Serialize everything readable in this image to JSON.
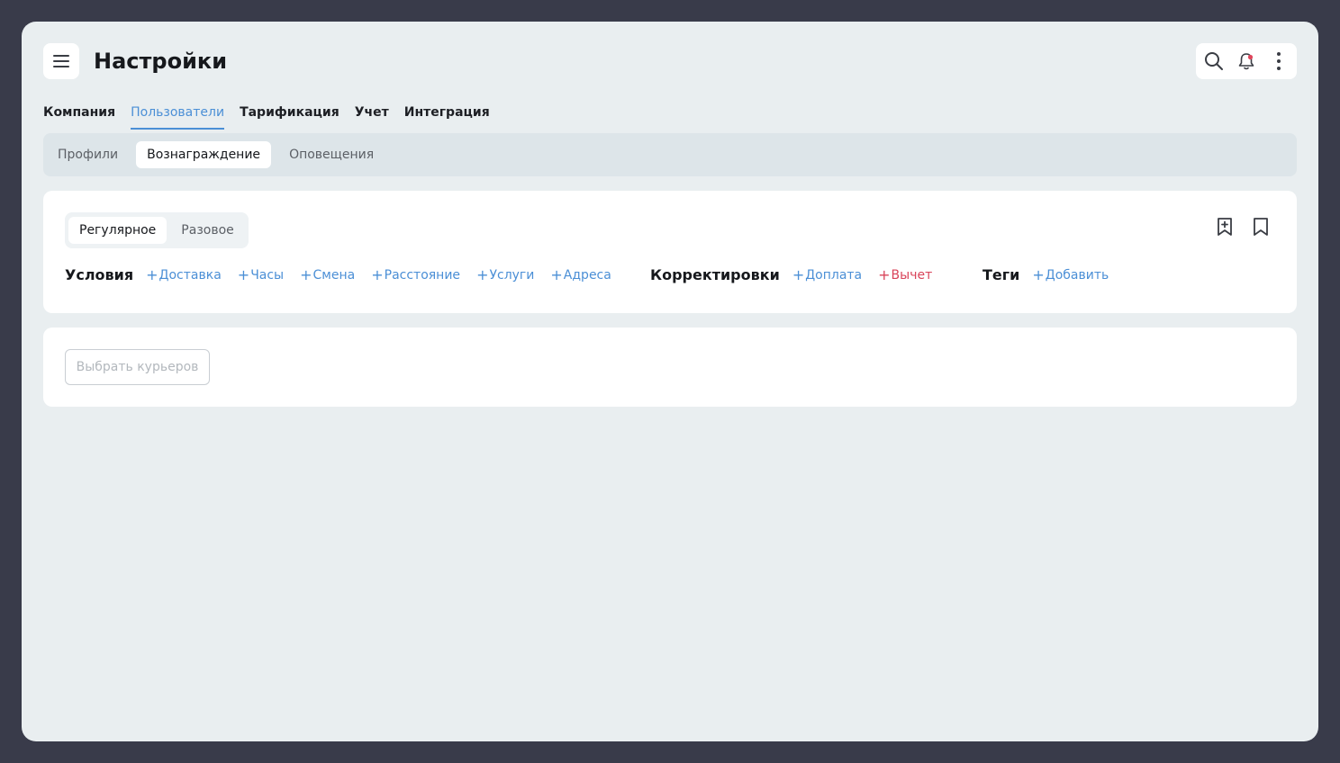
{
  "header": {
    "title": "Настройки",
    "icons": [
      "menu-icon",
      "search-icon",
      "bell-icon",
      "more-vertical-icon"
    ]
  },
  "tabs": [
    {
      "label": "Компания",
      "active": false
    },
    {
      "label": "Пользователи",
      "active": true
    },
    {
      "label": "Тарификация",
      "active": false
    },
    {
      "label": "Учет",
      "active": false
    },
    {
      "label": "Интеграция",
      "active": false
    }
  ],
  "subtabs": [
    {
      "label": "Профили",
      "active": false
    },
    {
      "label": "Вознаграждение",
      "active": true
    },
    {
      "label": "Оповещения",
      "active": false
    }
  ],
  "reward_type": {
    "options": [
      {
        "label": "Регулярное",
        "active": true
      },
      {
        "label": "Разовое",
        "active": false
      }
    ]
  },
  "conditions": {
    "label": "Условия",
    "items": [
      "Доставка",
      "Часы",
      "Смена",
      "Расстояние",
      "Услуги",
      "Адреса"
    ]
  },
  "adjustments": {
    "label": "Корректировки",
    "surcharge": "Доплата",
    "deduction": "Вычет"
  },
  "tags": {
    "label": "Теги",
    "add": "Добавить"
  },
  "couriers": {
    "select_label": "Выбрать курьеров"
  },
  "colors": {
    "accent": "#4b8fd6",
    "danger": "#d9445a",
    "notification_dot": "#e0455b"
  },
  "bookmark_icons": [
    "bookmark-add-icon",
    "bookmark-icon"
  ]
}
